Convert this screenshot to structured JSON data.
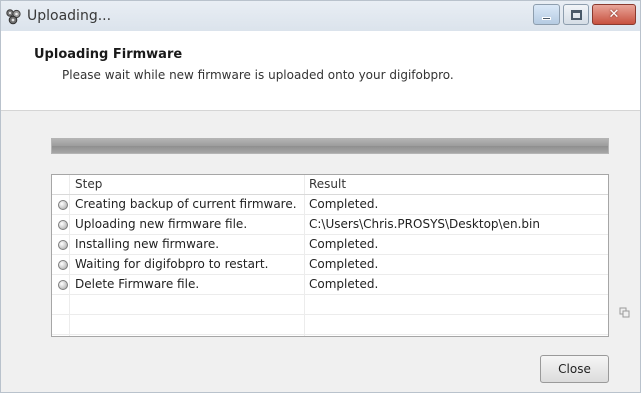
{
  "window": {
    "title": "Uploading...",
    "icon": "gear-cluster-icon",
    "controls": [
      "minimize-icon",
      "maximize-icon",
      "close-icon"
    ]
  },
  "header": {
    "title": "Uploading Firmware",
    "subtitle": "Please wait while new firmware is uploaded onto your digifobpro."
  },
  "progress": {
    "fraction": 1.0
  },
  "table": {
    "columns": [
      "Step",
      "Result"
    ],
    "rows": [
      {
        "step": "Creating backup of current firmware.",
        "result": "Completed.",
        "icon": "status-dot-icon"
      },
      {
        "step": "Uploading new firmware file.",
        "result": "C:\\Users\\Chris.PROSYS\\Desktop\\en.bin",
        "icon": "status-dot-icon"
      },
      {
        "step": "Installing new firmware.",
        "result": "Completed.",
        "icon": "status-dot-icon"
      },
      {
        "step": "Waiting for digifobpro to restart.",
        "result": "Completed.",
        "icon": "status-dot-icon"
      },
      {
        "step": "Delete Firmware file.",
        "result": "Completed.",
        "icon": "status-dot-icon"
      }
    ]
  },
  "footer": {
    "close_label": "Close"
  },
  "colors": {
    "accent": "#c7513f",
    "progress": "#9c9c9c"
  }
}
